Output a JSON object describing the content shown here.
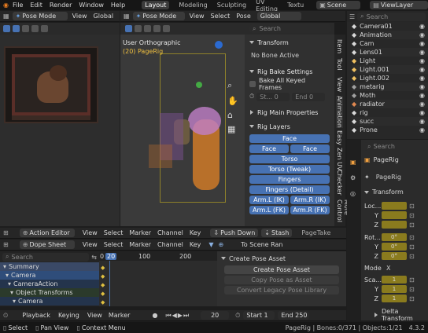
{
  "topbar": {
    "menu": [
      "File",
      "Edit",
      "Render",
      "Window",
      "Help"
    ],
    "workspaces": [
      "Layout",
      "Modeling",
      "Sculpting",
      "UV Editing",
      "Textu"
    ],
    "active_workspace": "Layout",
    "scene": "Scene",
    "view_layer": "ViewLayer"
  },
  "left_editor": {
    "mode": "Pose Mode",
    "menu": [
      "View"
    ],
    "orientation": "Global"
  },
  "viewport": {
    "mode": "Pose Mode",
    "menu": [
      "View",
      "Select",
      "Pose"
    ],
    "orientation": "Global",
    "overlay_title": "User Orthographic",
    "overlay_sub": "(20) PageRig",
    "search_placeholder": "Search",
    "side_tabs": [
      "Item",
      "Tool",
      "View",
      "Animation",
      "Easy",
      "Zen UV",
      "Checker",
      "More Control"
    ]
  },
  "n_panel": {
    "transform_header": "Transform",
    "no_bone": "No Bone Active",
    "bake_header": "Rig Bake Settings",
    "bake_all": "Bake All Keyed Frames",
    "start_label": "St...",
    "start_value": "0",
    "end_label": "End",
    "end_value": "0",
    "main_props": "Rig Main Properties",
    "layers_header": "Rig Layers",
    "layers": [
      [
        "Face"
      ],
      [
        "Face (Primary)",
        "Face (Seco..."
      ],
      [
        "Torso"
      ],
      [
        "Torso (Tweak)"
      ],
      [
        "Fingers"
      ],
      [
        "Fingers (Detail)"
      ],
      [
        "Arm.L (IK)",
        "Arm.R (IK)"
      ],
      [
        "Arm.L (FK)",
        "Arm.R (FK)"
      ]
    ]
  },
  "outliner": {
    "search_placeholder": "Search",
    "items": [
      {
        "name": "Camera01",
        "color": "#d9d9d9"
      },
      {
        "name": "Animation",
        "color": "#d9d9d9"
      },
      {
        "name": "Cam",
        "color": "#d9d9d9"
      },
      {
        "name": "Lens01",
        "color": "#d9d9d9"
      },
      {
        "name": "Light",
        "color": "#f0c060"
      },
      {
        "name": "Light.001",
        "color": "#f0c060"
      },
      {
        "name": "Light.002",
        "color": "#f0c060"
      },
      {
        "name": "metarig",
        "color": "#a0a0a0"
      },
      {
        "name": "Moth",
        "color": "#a0a0a0"
      },
      {
        "name": "radiator",
        "color": "#e08850"
      },
      {
        "name": "rig",
        "color": "#d9d9d9"
      },
      {
        "name": "succ",
        "color": "#d9d9d9"
      },
      {
        "name": "Prone",
        "color": "#d9d9d9"
      }
    ]
  },
  "properties": {
    "search_placeholder": "Search",
    "object_name": "PageRig",
    "data_name": "PageRig",
    "transform_header": "Transform",
    "loc_label": "Loc...",
    "rot_label": "Rot...",
    "scale_label": "Sca...",
    "axes": [
      "X",
      "Y",
      "Z"
    ],
    "loc_values": [
      "",
      "",
      ""
    ],
    "rot_values": [
      "0°",
      "0°",
      "0°"
    ],
    "scale_values": [
      "1",
      "1",
      "1"
    ],
    "mode_label": "Mode",
    "mode_value": "X",
    "delta_header": "Delta Transform"
  },
  "action_editor": {
    "type": "Action Editor",
    "menu": [
      "View",
      "Select",
      "Marker",
      "Channel",
      "Key"
    ],
    "push_down": "Push Down",
    "stash": "Stash",
    "page_take": "PageTake"
  },
  "dope_sheet": {
    "type": "Dope Sheet",
    "menu": [
      "View",
      "Select",
      "Marker",
      "Channel",
      "Key"
    ],
    "to_scene": "To Scene Ran",
    "search_placeholder": "Search",
    "current_frame": "20",
    "ruler": [
      "0",
      "20",
      "100",
      "200"
    ],
    "channels": [
      {
        "name": "Summary",
        "bg": "#3a4966"
      },
      {
        "name": "Camera",
        "bg": "#2f4d7a"
      },
      {
        "name": "CameraAction",
        "bg": "#24344c"
      },
      {
        "name": "Object Transforms",
        "bg": "#2b3a2b"
      },
      {
        "name": "Camera",
        "bg": "#24344c"
      }
    ],
    "pose_asset_header": "Create Pose Asset",
    "pose_buttons": [
      "Create Pose Asset",
      "Copy Pose as Asset",
      "Convert Legacy Pose Library"
    ]
  },
  "timeline": {
    "menu": [
      "Playback",
      "Keying",
      "View",
      "Marker"
    ],
    "frame": "20",
    "start_label": "Start",
    "start_value": "1",
    "end_label": "End",
    "end_value": "250"
  },
  "statusbar": {
    "select": "Select",
    "pan": "Pan View",
    "context": "Context Menu",
    "info": "PageRig | Bones:0/371 | Objects:1/21",
    "version": "4.3.2"
  }
}
